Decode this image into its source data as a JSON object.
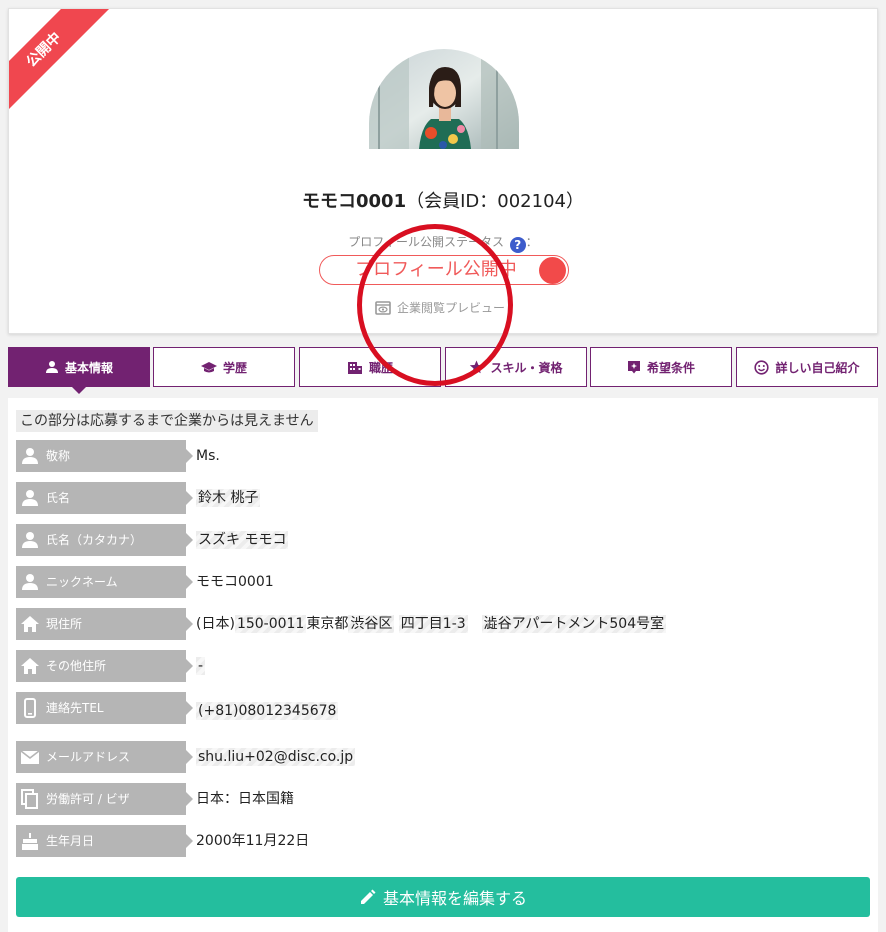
{
  "profile": {
    "ribbon": "公開中",
    "member_name": "モモコ0001",
    "member_id_text": "（会員ID：002104）",
    "status_label": "プロフィール公開ステータス",
    "status_suffix": "：",
    "help_glyph": "?",
    "status_pill": "プロフィール公開中",
    "preview_link": "企業閲覧プレビュー"
  },
  "tabs": [
    {
      "label": "基本情報",
      "icon": "person-icon",
      "active": true
    },
    {
      "label": "学歴",
      "icon": "graduation-cap-icon",
      "active": false
    },
    {
      "label": "職歴",
      "icon": "building-icon",
      "active": false
    },
    {
      "label": "スキル・資格",
      "icon": "star-icon",
      "active": false
    },
    {
      "label": "希望条件",
      "icon": "sparkle-flag-icon",
      "active": false
    },
    {
      "label": "詳しい自己紹介",
      "icon": "smile-icon",
      "active": false
    }
  ],
  "notice": "この部分は応募するまで企業からは見えません",
  "fields": [
    {
      "label": "敬称",
      "icon": "person-icon",
      "value": "Ms."
    },
    {
      "label": "氏名",
      "icon": "person-icon",
      "value": "鈴木 桃子"
    },
    {
      "label": "氏名（カタカナ）",
      "icon": "person-icon",
      "value": "スズキ モモコ"
    },
    {
      "label": "ニックネーム",
      "icon": "person-icon",
      "value": "モモコ0001"
    },
    {
      "label": "現住所",
      "icon": "home-icon",
      "value_parts": [
        "(日本)",
        "150-0011",
        "東京都",
        "渋谷区",
        "四丁目1-3",
        "澁谷アパートメント504号室"
      ]
    },
    {
      "label": "その他住所",
      "icon": "home-icon",
      "value": "-"
    },
    {
      "label": "連絡先TEL",
      "icon": "phone-icon",
      "value": "(+81)08012345678"
    },
    {
      "label": "メールアドレス",
      "icon": "mail-icon",
      "value": "shu.liu+02@disc.co.jp"
    },
    {
      "label": "労働許可 / ビザ",
      "icon": "copy-icon",
      "value": "日本：日本国籍"
    },
    {
      "label": "生年月日",
      "icon": "cake-icon",
      "value": "2000年11月22日"
    }
  ],
  "edit_button": "基本情報を編集する",
  "colors": {
    "accent": "#722271",
    "published": "#f05a5a",
    "edit": "#24be9e",
    "ribbon": "#f0474f",
    "annotation": "#d80f21"
  }
}
